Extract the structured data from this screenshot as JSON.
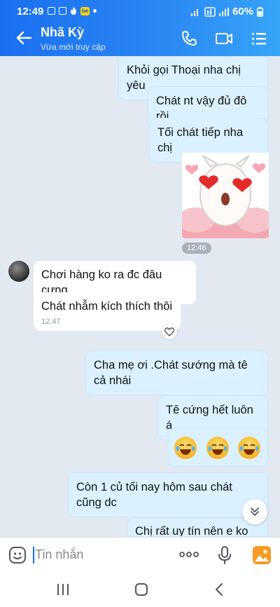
{
  "status_bar": {
    "time": "12:49",
    "battery": "60%"
  },
  "header": {
    "contact_name": "Nhã Kỳ",
    "subtitle": "Vừa mới truy cập"
  },
  "messages": [
    {
      "text": "Khỏi gọi Thoại nha chị yêu"
    },
    {
      "text": "Chát nt vậy đủ đô rồi"
    },
    {
      "text": "Tối chát tiếp nha chị"
    },
    {
      "time": "12:46"
    },
    {
      "text": "Chơi hàng ko ra đc đâu cưng"
    },
    {
      "text": "Chát nhẫm kích thích thôi",
      "time": "12:47"
    },
    {
      "text": "Cha mẹ ơi .Chát sướng mà tê cả nhái"
    },
    {
      "text": "Tê cứng hết luôn á"
    },
    {
      "text": "Còn 1 củ tối nay hôm sau chát cũng dc"
    },
    {
      "text": "Chị rất uy tín nên e ko sợ"
    }
  ],
  "composer": {
    "placeholder": "Tin nhắn"
  },
  "colors": {
    "accent": "#1a6ff0",
    "my_bubble": "#dbf1ff",
    "their_bubble": "#ffffff",
    "background": "#e2e9f1"
  }
}
